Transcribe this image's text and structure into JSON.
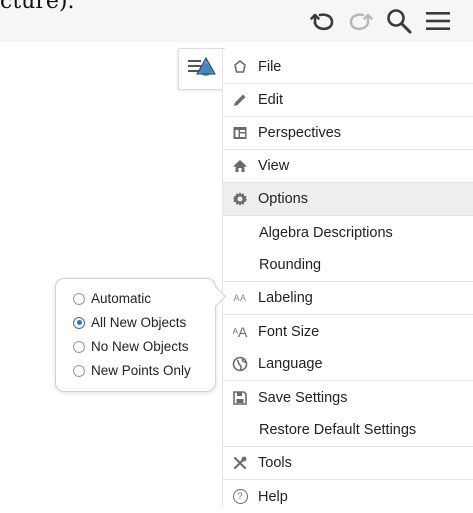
{
  "top_caption": "cture).",
  "colors": {
    "accent": "#3b6fc2",
    "menu_active_bg": "#eeeeee",
    "icon_gray": "#6b6b6b",
    "toggle_triangle": "#3f7fd0",
    "toggle_circle": "#58b44e"
  },
  "toolbar": {
    "undo_icon": "undo-icon",
    "redo_icon": "redo-icon",
    "search_icon": "search-icon",
    "menu_icon": "hamburger-menu-icon"
  },
  "view_toggle": {
    "icon": "algebra-view-toggle-icon"
  },
  "menu": {
    "items": [
      {
        "label": "File",
        "icon": "file-icon"
      },
      {
        "label": "Edit",
        "icon": "pencil-icon"
      },
      {
        "label": "Perspectives",
        "icon": "perspectives-icon"
      },
      {
        "label": "View",
        "icon": "view-house-icon"
      },
      {
        "label": "Options",
        "icon": "gear-icon"
      },
      {
        "label": "Algebra Descriptions",
        "icon": ""
      },
      {
        "label": "Rounding",
        "icon": ""
      },
      {
        "label": "Labeling",
        "icon": "labeling-aa-icon",
        "icon_text": "AA"
      },
      {
        "label": "Font Size",
        "icon": "font-size-aa-icon",
        "icon_text": "AA"
      },
      {
        "label": "Language",
        "icon": "language-globe-icon"
      },
      {
        "label": "Save Settings",
        "icon": "save-disk-icon"
      },
      {
        "label": "Restore Default Settings",
        "icon": ""
      },
      {
        "label": "Tools",
        "icon": "tools-icon"
      },
      {
        "label": "Help",
        "icon": "help-question-icon",
        "icon_text": "?"
      }
    ],
    "active_item": "Options"
  },
  "labeling_popup": {
    "options": [
      {
        "label": "Automatic",
        "selected": false
      },
      {
        "label": "All New Objects",
        "selected": true
      },
      {
        "label": "No New Objects",
        "selected": false
      },
      {
        "label": "New Points Only",
        "selected": false
      }
    ]
  }
}
